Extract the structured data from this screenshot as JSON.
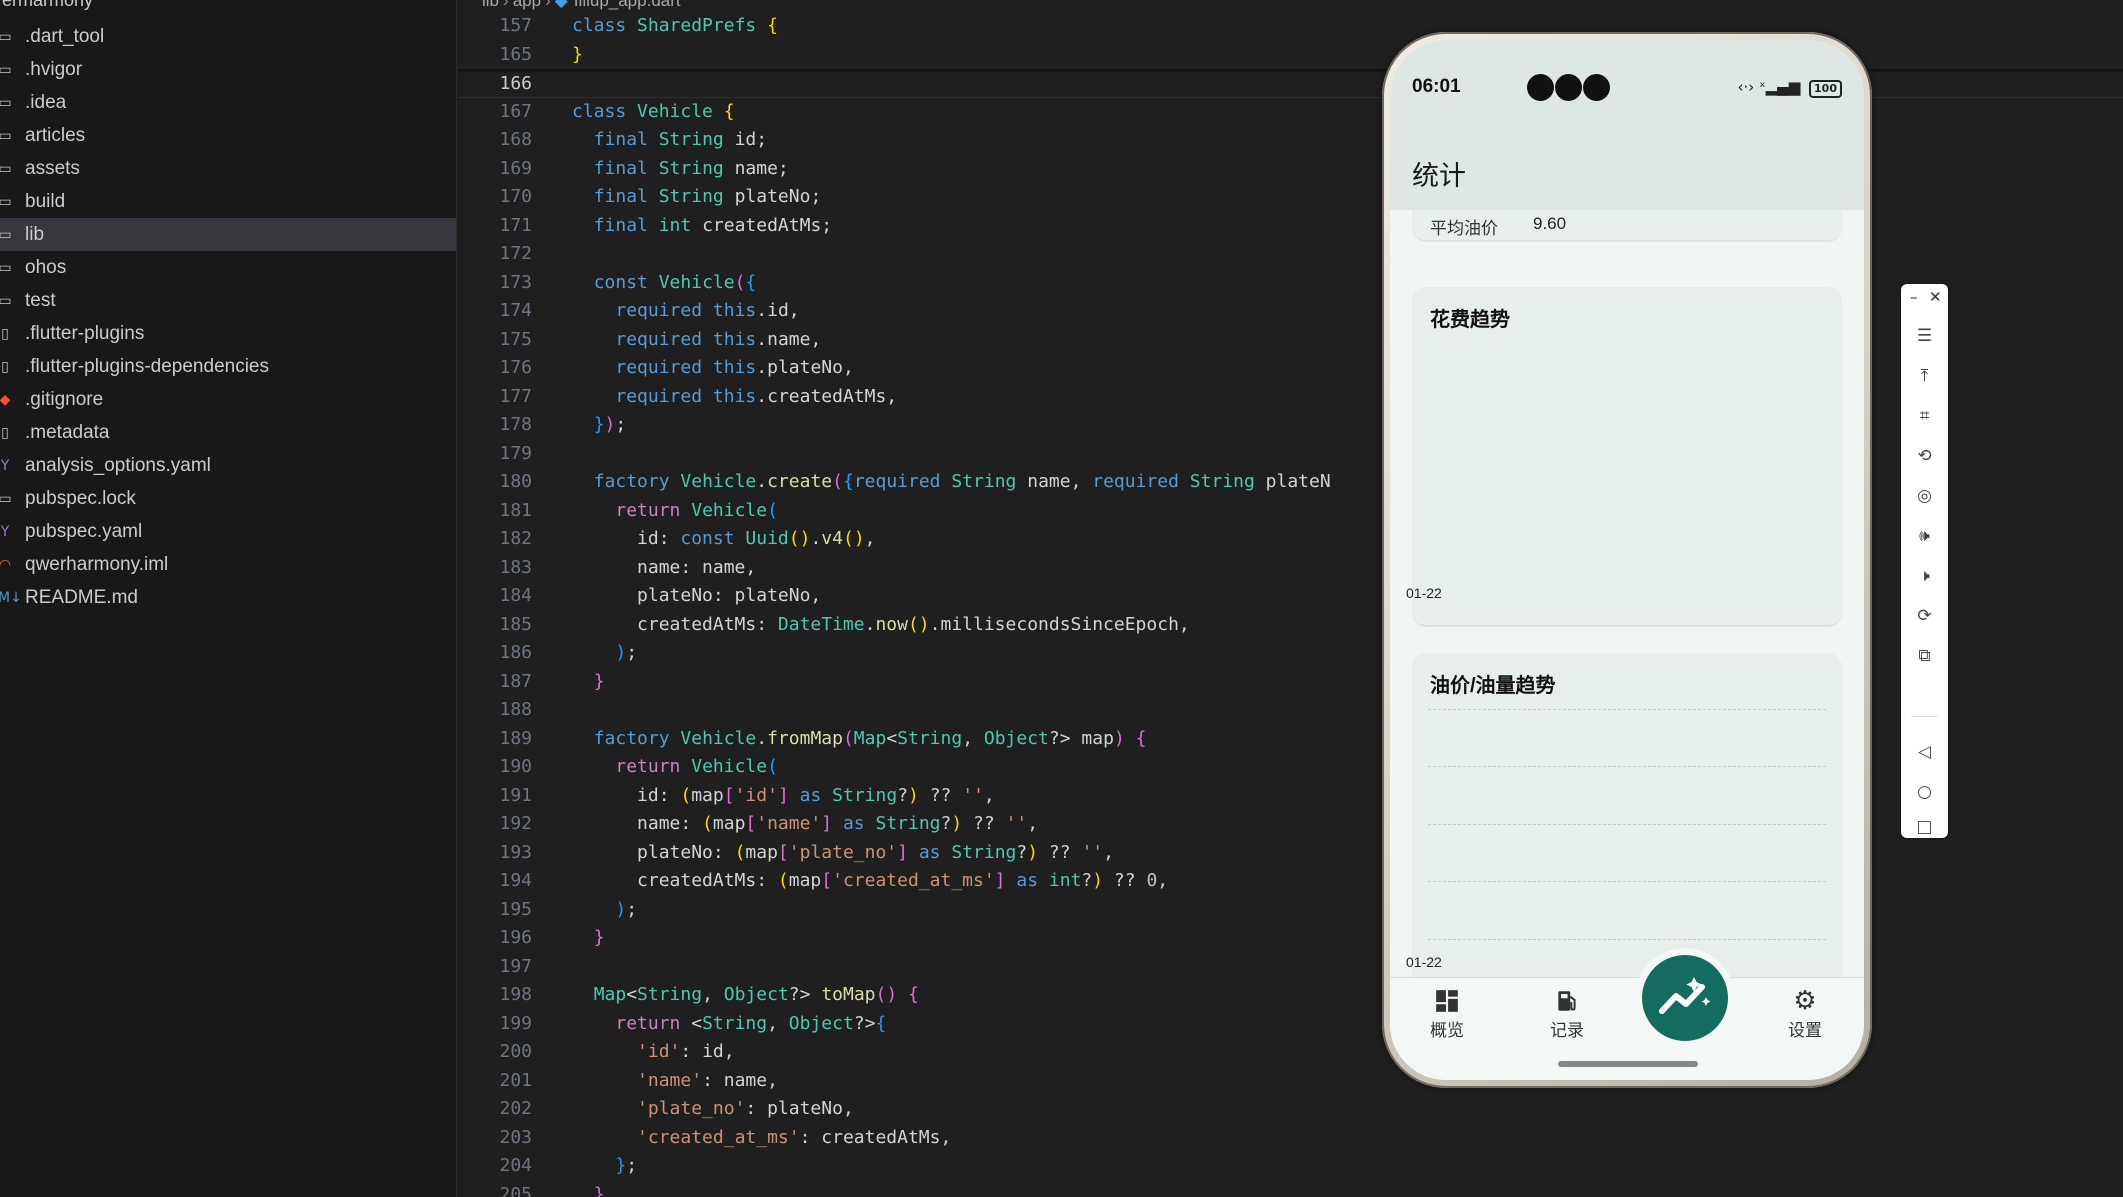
{
  "explorer": {
    "root_label": "ermarmony",
    "items": [
      {
        "icon": "folder-icon",
        "label": ".dart_tool"
      },
      {
        "icon": "folder-icon",
        "label": ".hvigor"
      },
      {
        "icon": "folder-icon",
        "label": ".idea"
      },
      {
        "icon": "folder-icon",
        "label": "articles"
      },
      {
        "icon": "folder-icon",
        "label": "assets"
      },
      {
        "icon": "folder-icon",
        "label": "build"
      },
      {
        "icon": "folder-icon",
        "label": "lib",
        "selected": true
      },
      {
        "icon": "folder-icon",
        "label": "ohos"
      },
      {
        "icon": "folder-icon",
        "label": "test"
      },
      {
        "icon": "file-icon",
        "label": ".flutter-plugins"
      },
      {
        "icon": "file-icon",
        "label": ".flutter-plugins-dependencies"
      },
      {
        "icon": "git-icon",
        "label": ".gitignore"
      },
      {
        "icon": "file-icon",
        "label": ".metadata"
      },
      {
        "icon": "yaml-icon",
        "label": "analysis_options.yaml"
      },
      {
        "icon": "lock-icon",
        "label": "pubspec.lock"
      },
      {
        "icon": "yaml-icon",
        "label": "pubspec.yaml"
      },
      {
        "icon": "rss-icon",
        "label": "qwerharmony.iml"
      },
      {
        "icon": "markdown-icon",
        "label": "README.md"
      }
    ]
  },
  "editor": {
    "breadcrumb": [
      "lib",
      "app",
      "fillup_app.dart"
    ],
    "active_line": "166",
    "lines": [
      {
        "n": "157",
        "html": "<span class=\"k\">class</span> <span class=\"t\">SharedPrefs</span> <span class=\"c1\">{</span>"
      },
      {
        "n": "165",
        "html": "<span class=\"c1\">}</span>"
      },
      {
        "n": "166",
        "html": ""
      },
      {
        "n": "167",
        "html": "<span class=\"k\">class</span> <span class=\"t\">Vehicle</span> <span class=\"c1\">{</span>"
      },
      {
        "n": "168",
        "html": "  <span class=\"k\">final</span> <span class=\"t\">String</span> id;"
      },
      {
        "n": "169",
        "html": "  <span class=\"k\">final</span> <span class=\"t\">String</span> name;"
      },
      {
        "n": "170",
        "html": "  <span class=\"k\">final</span> <span class=\"t\">String</span> plateNo;"
      },
      {
        "n": "171",
        "html": "  <span class=\"k\">final</span> <span class=\"t\">int</span> createdAtMs;"
      },
      {
        "n": "172",
        "html": ""
      },
      {
        "n": "173",
        "html": "  <span class=\"k\">const</span> <span class=\"t\">Vehicle</span><span class=\"c2\">(</span><span class=\"c3\">{</span>"
      },
      {
        "n": "174",
        "html": "    <span class=\"k\">required</span> <span class=\"k\">this</span>.id,"
      },
      {
        "n": "175",
        "html": "    <span class=\"k\">required</span> <span class=\"k\">this</span>.name,"
      },
      {
        "n": "176",
        "html": "    <span class=\"k\">required</span> <span class=\"k\">this</span>.plateNo,"
      },
      {
        "n": "177",
        "html": "    <span class=\"k\">required</span> <span class=\"k\">this</span>.createdAtMs,"
      },
      {
        "n": "178",
        "html": "  <span class=\"c3\">}</span><span class=\"c2\">)</span>;"
      },
      {
        "n": "179",
        "html": ""
      },
      {
        "n": "180",
        "html": "  <span class=\"k\">factory</span> <span class=\"t\">Vehicle</span>.<span class=\"f\">create</span><span class=\"c2\">(</span><span class=\"c3\">{</span><span class=\"k\">required</span> <span class=\"t\">String</span> name, <span class=\"k\">required</span> <span class=\"t\">String</span> plateN"
      },
      {
        "n": "181",
        "html": "    <span class=\"kc\">return</span> <span class=\"t\">Vehicle</span><span class=\"c3\">(</span>"
      },
      {
        "n": "182",
        "html": "      id: <span class=\"k\">const</span> <span class=\"t\">Uuid</span><span class=\"c1\">()</span>.<span class=\"f\">v4</span><span class=\"c1\">()</span>,"
      },
      {
        "n": "183",
        "html": "      name: name,"
      },
      {
        "n": "184",
        "html": "      plateNo: plateNo,"
      },
      {
        "n": "185",
        "html": "      createdAtMs: <span class=\"t\">DateTime</span>.<span class=\"f\">now</span><span class=\"c1\">()</span>.millisecondsSinceEpoch,"
      },
      {
        "n": "186",
        "html": "    <span class=\"c3\">)</span>;"
      },
      {
        "n": "187",
        "html": "  <span class=\"c2\">}</span>"
      },
      {
        "n": "188",
        "html": ""
      },
      {
        "n": "189",
        "html": "  <span class=\"k\">factory</span> <span class=\"t\">Vehicle</span>.<span class=\"f\">fromMap</span><span class=\"c2\">(</span><span class=\"t\">Map</span>&lt;<span class=\"t\">String</span>, <span class=\"t\">Object</span>?&gt; map<span class=\"c2\">)</span> <span class=\"c2\">{</span>"
      },
      {
        "n": "190",
        "html": "    <span class=\"kc\">return</span> <span class=\"t\">Vehicle</span><span class=\"c3\">(</span>"
      },
      {
        "n": "191",
        "html": "      id: <span class=\"c1\">(</span>map<span class=\"c2\">[</span><span class=\"s\">'id'</span><span class=\"c2\">]</span> <span class=\"k\">as</span> <span class=\"t\">String</span>?<span class=\"c1\">)</span> ?? <span class=\"s\">''</span>,"
      },
      {
        "n": "192",
        "html": "      name: <span class=\"c1\">(</span>map<span class=\"c2\">[</span><span class=\"s\">'name'</span><span class=\"c2\">]</span> <span class=\"k\">as</span> <span class=\"t\">String</span>?<span class=\"c1\">)</span> ?? <span class=\"s\">''</span>,"
      },
      {
        "n": "193",
        "html": "      plateNo: <span class=\"c1\">(</span>map<span class=\"c2\">[</span><span class=\"s\">'plate_no'</span><span class=\"c2\">]</span> <span class=\"k\">as</span> <span class=\"t\">String</span>?<span class=\"c1\">)</span> ?? <span class=\"s\">''</span>,"
      },
      {
        "n": "194",
        "html": "      createdAtMs: <span class=\"c1\">(</span>map<span class=\"c2\">[</span><span class=\"s\">'created_at_ms'</span><span class=\"c2\">]</span> <span class=\"k\">as</span> <span class=\"t\">int</span>?<span class=\"c1\">)</span> ?? <span class=\"n\">0</span>,"
      },
      {
        "n": "195",
        "html": "    <span class=\"c3\">)</span>;"
      },
      {
        "n": "196",
        "html": "  <span class=\"c2\">}</span>"
      },
      {
        "n": "197",
        "html": ""
      },
      {
        "n": "198",
        "html": "  <span class=\"t\">Map</span>&lt;<span class=\"t\">String</span>, <span class=\"t\">Object</span>?&gt; <span class=\"f\">toMap</span><span class=\"c2\">()</span> <span class=\"c2\">{</span>"
      },
      {
        "n": "199",
        "html": "    <span class=\"kc\">return</span> &lt;<span class=\"t\">String</span>, <span class=\"t\">Object</span>?&gt;<span class=\"c3\">{</span>"
      },
      {
        "n": "200",
        "html": "      <span class=\"s\">'id'</span>: id,"
      },
      {
        "n": "201",
        "html": "      <span class=\"s\">'name'</span>: name,"
      },
      {
        "n": "202",
        "html": "      <span class=\"s\">'plate_no'</span>: plateNo,"
      },
      {
        "n": "203",
        "html": "      <span class=\"s\">'created_at_ms'</span>: createdAtMs,"
      },
      {
        "n": "204",
        "html": "    <span class=\"c3\">}</span>;"
      },
      {
        "n": "205",
        "html": "  <span class=\"c2\">}</span>"
      }
    ]
  },
  "phone": {
    "status_time": "06:01",
    "battery": "100",
    "app_title": "统计",
    "avg_price_label": "平均油价",
    "avg_price_value": "9.60",
    "spend_card_title": "花费趋势",
    "spend_card_xtick": "01-22",
    "price_card_title": "油价/油量趋势",
    "price_card_xtick": "01-22",
    "nav": [
      {
        "icon": "dashboard-icon",
        "label": "概览"
      },
      {
        "icon": "fuel-icon",
        "label": "记录"
      },
      {
        "icon": "trend-icon",
        "label": ""
      },
      {
        "icon": "gear-icon",
        "label": "设置"
      }
    ],
    "accent_color": "#136c5d"
  },
  "emulator_toolbar": {
    "buttons": [
      "minimize",
      "close",
      "menu",
      "pin-top",
      "screenshot",
      "rotate",
      "location",
      "volume-up",
      "volume-down",
      "shake",
      "multi-screen",
      "back",
      "home",
      "recents"
    ]
  }
}
